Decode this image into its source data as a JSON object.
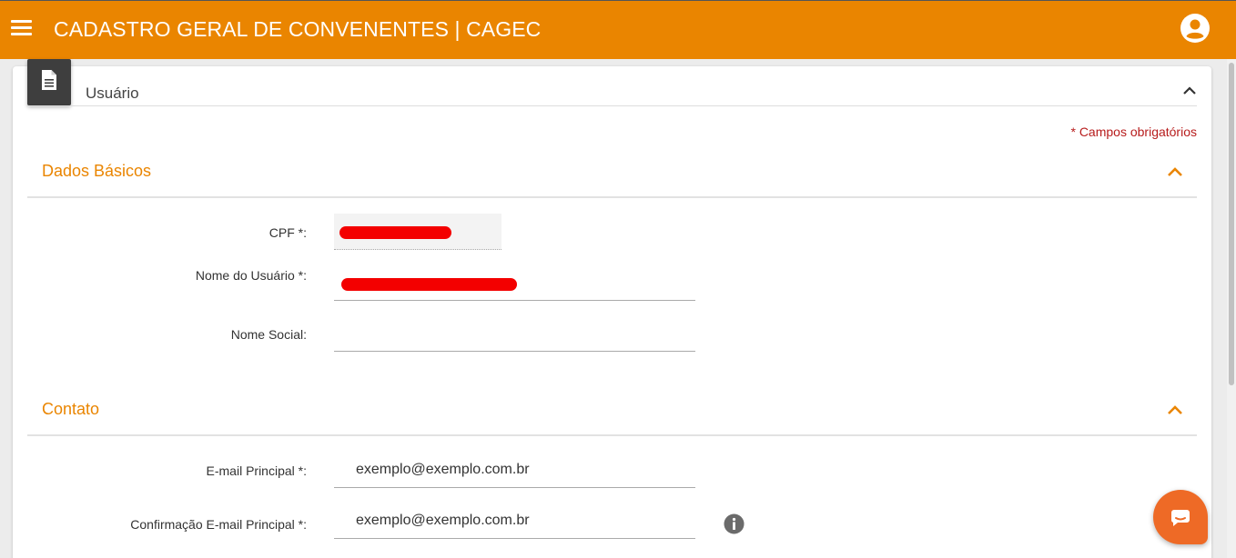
{
  "header": {
    "title": "CADASTRO GERAL DE CONVENENTES | CAGEC",
    "menu_icon": "hamburger-menu-icon",
    "user_icon": "account-circle-icon",
    "background_color": "#ea8500"
  },
  "card": {
    "title": "Usuário",
    "icon": "document-icon",
    "required_note": "* Campos obrigatórios"
  },
  "sections": {
    "basic": {
      "title": "Dados Básicos",
      "fields": {
        "cpf": {
          "label": "CPF *:",
          "value": ""
        },
        "name": {
          "label": "Nome do Usuário *:",
          "value": ""
        },
        "social_name": {
          "label": "Nome Social:",
          "value": ""
        }
      }
    },
    "contact": {
      "title": "Contato",
      "fields": {
        "email": {
          "label": "E-mail Principal *:",
          "value": "exemplo@exemplo.com.br"
        },
        "email_confirm": {
          "label": "Confirmação E-mail Principal *:",
          "value": "exemplo@exemplo.com.br"
        }
      }
    }
  },
  "colors": {
    "accent": "#ea8500",
    "required": "#b71c1c",
    "chat": "#ee6a26",
    "redaction": "#f30000"
  }
}
